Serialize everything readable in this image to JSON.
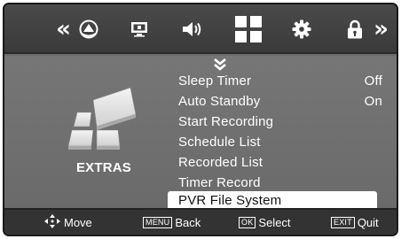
{
  "top_bar": {
    "icons": [
      "chevron-double-left-icon",
      "picture-icon",
      "screen-icon",
      "speaker-icon",
      "extras-grid-icon",
      "gear-icon",
      "lock-icon",
      "chevron-double-right-icon"
    ],
    "left_arrow": "«",
    "right_arrow": "»",
    "selected_index": 4
  },
  "category": {
    "label": "EXTRAS"
  },
  "menu": {
    "items": [
      {
        "label": "Sleep Timer",
        "value": "Off"
      },
      {
        "label": "Auto Standby",
        "value": "On"
      },
      {
        "label": "Start Recording",
        "value": ""
      },
      {
        "label": "Schedule List",
        "value": ""
      },
      {
        "label": "Recorded List",
        "value": ""
      },
      {
        "label": "Timer Record",
        "value": ""
      },
      {
        "label": "PVR File System",
        "value": "",
        "selected": true
      }
    ]
  },
  "bottom_bar": {
    "move_label": "Move",
    "back_key": "MENU",
    "back_label": "Back",
    "select_key": "OK",
    "select_label": "Select",
    "quit_key": "EXIT",
    "quit_label": "Quit"
  },
  "colors": {
    "background": "#6b6b6b",
    "top_bar": "#3f3f3f",
    "bottom_bar": "#333333",
    "highlight": "#ffffff",
    "text": "#ffffff"
  }
}
